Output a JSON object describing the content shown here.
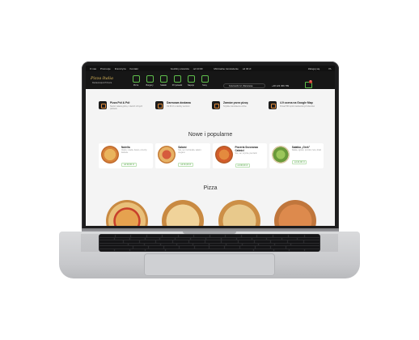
{
  "site": {
    "topbar": {
      "links": [
        "O nas",
        "Promocje",
        "Franczyza",
        "Kontakt"
      ],
      "hours_label": "Godziny otwarcia",
      "hours_value": "od 10:00",
      "min_order_label": "Minimalne zamówienie",
      "min_order_value": "od 30 zł",
      "account_label": "Zaloguj się",
      "lang": "PL"
    },
    "logo": {
      "text": "Pizza Italia",
      "sub": "Restauracja & Pizzeria"
    },
    "categories": [
      "Pizza",
      "Burgery",
      "Sałatki",
      "Przystawki",
      "Napoje",
      "Sosy"
    ],
    "address": "Kościuszki 12, Warszawa",
    "phone": "+48 123 456 789",
    "cart_count": "0",
    "features": [
      {
        "title": "Pizza Pół & Pół",
        "desc": "Stwórz własną pizzę z dwóch różnych połówek"
      },
      {
        "title": "Darmowa dostawa",
        "desc": "Od 60 zł w okolicy centrum"
      },
      {
        "title": "Zamów przez pizzę",
        "desc": "Szybkie zamówienie online"
      },
      {
        "title": "4.9 ocena na Google Map",
        "desc": "Ponad 500 opinii zadowolonych klientów"
      }
    ],
    "new_popular_title": "Nowe i popularne",
    "products": [
      {
        "name": "Nutella",
        "desc": "Ciasto, nutella, banan, orzechy laskowe",
        "price": "od 30,00 zł"
      },
      {
        "name": "Salami",
        "desc": "Sos, ser mozzarella, salami, oregano",
        "price": "od 31,00 zł"
      },
      {
        "name": "Pizzeria Sezonowa Całości",
        "desc": "Sos, ser, szynka, pieczarki",
        "price": "od 36,00 zł"
      },
      {
        "name": "Sałatka „Grek”",
        "desc": "Sałata, ogórek, pomidor, feta, oliwki",
        "price": "od 22,00 zł"
      }
    ],
    "pizza_section_title": "Pizza"
  }
}
